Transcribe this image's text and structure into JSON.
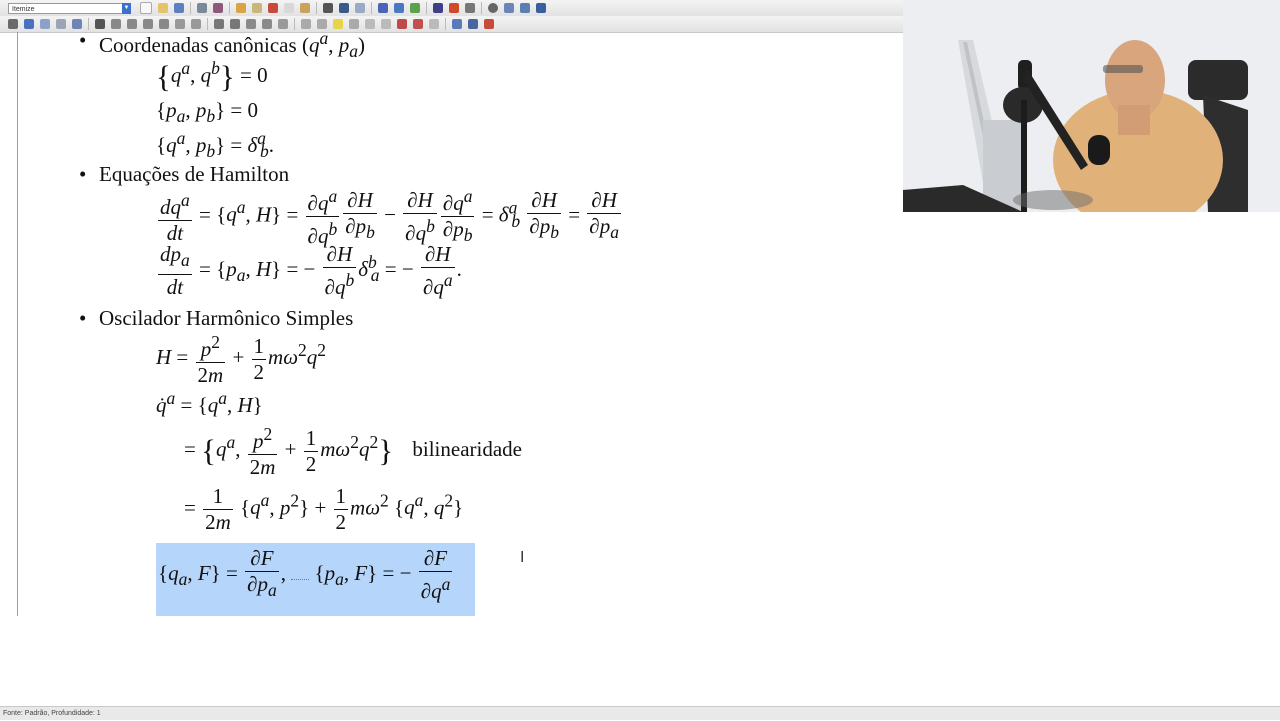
{
  "toolbar": {
    "style_select_value": "Itemize"
  },
  "document": {
    "bullets": [
      "Coordenadas canônicas",
      "Equações de Hamilton",
      "Oscilador Harmônico Simples"
    ],
    "annotation": "bilinearidade"
  },
  "statusbar": {
    "text": "Fonte: Padrão, Profundidade: 1"
  }
}
